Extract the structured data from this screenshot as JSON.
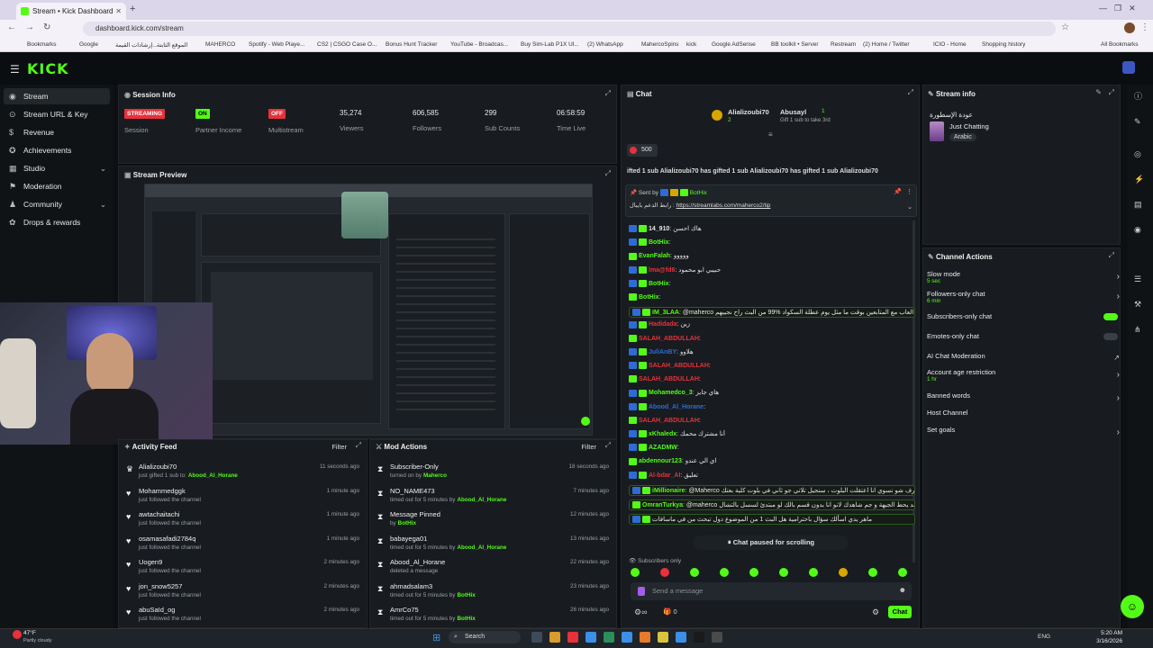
{
  "browser": {
    "tab_title": "Stream • Kick Dashboard",
    "url": "dashboard.kick.com/stream",
    "bookmarks": [
      "Bookmarks",
      "Google",
      "إرشادات القيمة...",
      "الموقع الثابتة",
      "MAHERCO",
      "Spotify - Web Playe...",
      "CS2 | CSGO Case O...",
      "Bonus Hunt Tracker",
      "YouTube - Broadcas...",
      "Buy Sim-Lab P1X Ul...",
      "(2) WhatsApp",
      "MahercoSpins",
      "kick",
      "Google AdSense",
      "BB toolkit • Server",
      "Restream",
      "(2) Home / Twitter",
      "ICIO - Home",
      "Shopping history",
      "All Bookmarks"
    ]
  },
  "kick": {
    "logo": "KICK",
    "sidebar": [
      {
        "label": "Stream",
        "icon": "stream-icon",
        "active": true
      },
      {
        "label": "Stream URL & Key",
        "icon": "key-icon"
      },
      {
        "label": "Revenue",
        "icon": "revenue-icon"
      },
      {
        "label": "Achievements",
        "icon": "achievement-icon"
      },
      {
        "label": "Studio",
        "icon": "studio-icon",
        "chevron": true
      },
      {
        "label": "Moderation",
        "icon": "moderation-icon"
      },
      {
        "label": "Community",
        "icon": "community-icon",
        "chevron": true
      },
      {
        "label": "Drops & rewards",
        "icon": "gift-icon"
      }
    ]
  },
  "session": {
    "title": "Session Info",
    "stats": [
      {
        "badge": "STREAMING",
        "badge_color": "#e8313a",
        "label": "Session"
      },
      {
        "badge": "ON",
        "badge_color": "#53fc18",
        "label": "Partner Income"
      },
      {
        "badge": "OFF",
        "badge_color": "#e8313a",
        "label": "Multistream"
      },
      {
        "value": "35,274",
        "label": "Viewers"
      },
      {
        "value": "606,585",
        "label": "Followers"
      },
      {
        "value": "299",
        "label": "Sub Counts"
      },
      {
        "value": "06:58:59",
        "label": "Time Live"
      }
    ]
  },
  "preview": {
    "title": "Stream Preview"
  },
  "activity": {
    "title": "Activity Feed",
    "filter": "Filter",
    "items": [
      {
        "name": "Alializoubi70",
        "desc": "just gifted 1 sub to:",
        "target": "Abood_Al_Horane",
        "time": "11 seconds ago"
      },
      {
        "name": "Mohammedggk",
        "desc": "just followed the channel",
        "time": "1 minute ago"
      },
      {
        "name": "awtachaitachi",
        "desc": "just followed the channel",
        "time": "1 minute ago"
      },
      {
        "name": "osamasafadi2784q",
        "desc": "just followed the channel",
        "time": "1 minute ago"
      },
      {
        "name": "Uogen9",
        "desc": "just followed the channel",
        "time": "2 minutes ago"
      },
      {
        "name": "jon_snow5257",
        "desc": "just followed the channel",
        "time": "2 minutes ago"
      },
      {
        "name": "abuSaId_og",
        "desc": "just followed the channel",
        "time": "2 minutes ago"
      }
    ]
  },
  "mod": {
    "title": "Mod Actions",
    "filter": "Filter",
    "items": [
      {
        "name": "Subscriber-Only",
        "desc": "turned on by",
        "by": "Maherco",
        "time": "18 seconds ago"
      },
      {
        "name": "NO_NAME473",
        "desc": "timed out for 5 minutes by",
        "by": "Abood_Al_Horane",
        "time": "7 minutes ago"
      },
      {
        "name": "Message Pinned",
        "desc": "by",
        "by": "BotHix",
        "time": "12 minutes ago"
      },
      {
        "name": "babayega01",
        "desc": "timed out for 5 minutes by",
        "by": "Abood_Al_Horane",
        "time": "13 minutes ago"
      },
      {
        "name": "Abood_Al_Horane",
        "desc": "deleted a message",
        "by": "",
        "time": "22 minutes ago"
      },
      {
        "name": "ahmadsalam3",
        "desc": "timed out for 5 minutes by",
        "by": "BotHix",
        "time": "23 minutes ago"
      },
      {
        "name": "AmrCo75",
        "desc": "timed out for 5 minutes by",
        "by": "BotHix",
        "time": "26 minutes ago"
      }
    ]
  },
  "chat": {
    "title": "Chat",
    "top_gifter": {
      "name": "Alializoubi70",
      "count": "2"
    },
    "second_gifter": {
      "name": "Abusayl",
      "count": "1",
      "note": "Gift 1 sub to take 3rd"
    },
    "goal": "500",
    "gift_ticker": "ifted 1 sub   Alializoubi70 has gifted 1 sub   Alializoubi70 has gifted 1 sub   Alializoubi70",
    "pinned_by": "Sent by",
    "pinned_user": "BotHix",
    "pinned_label": "رابط الدعم بايبال :",
    "pinned_link": "https://streamlabs.com/maherco2/tip",
    "messages": [
      {
        "user": "14_910",
        "text": "هاك احسن",
        "color": "#e6e6e6"
      },
      {
        "user": "BotHix",
        "text": "",
        "color": "#53fc18"
      },
      {
        "user": "EvanFalah",
        "text": "ووووو",
        "color": "#53fc18"
      },
      {
        "user": "lma@fd6",
        "text": "حبيبي ابو محمود",
        "color": "#e8313a"
      },
      {
        "user": "BotHix",
        "text": "",
        "color": "#53fc18"
      },
      {
        "user": "BotHix",
        "text": "",
        "color": "#53fc18"
      },
      {
        "user": "IM_3LAA",
        "text": "@maherco اعمل الشات للمشتركين عشان فرصة العاب مع المتابعين بوقت ما مثل يوم عطلة السكواد %99 من البث راح نجيبهم",
        "color": "#53fc18"
      },
      {
        "user": "Hadidada",
        "text": "زين",
        "color": "#e8313a"
      },
      {
        "user": "SALAH_ABDULLAH",
        "text": "",
        "color": "#e8313a"
      },
      {
        "user": "JuliAnBY",
        "text": "هلاوو",
        "color": "#2e6bd6"
      },
      {
        "user": "SALAH_ABDULLAH",
        "text": "",
        "color": "#e8313a"
      },
      {
        "user": "SALAH_ABDULLAH",
        "text": "",
        "color": "#e8313a"
      },
      {
        "user": "Mohamedco_3",
        "text": "هاي جايز",
        "color": "#53fc18"
      },
      {
        "user": "Abood_Al_Horane",
        "text": "",
        "color": "#2e6bd6"
      },
      {
        "user": "SALAH_ABDULLAH",
        "text": "",
        "color": "#e8313a"
      },
      {
        "user": "xKhaledx",
        "text": "أنا مشترك محمك",
        "color": "#53fc18"
      },
      {
        "user": "AZADMW",
        "text": "",
        "color": "#53fc18"
      },
      {
        "user": "abdennour123",
        "text": "اي الي عندو",
        "color": "#53fc18"
      },
      {
        "user": "Al-bdar_AI",
        "text": "تعليق",
        "color": "#e8313a"
      },
      {
        "user": "iMillionaire",
        "text": "@Maherco و الله ما يتعرف شو نسوي انا اعتقلت البلوت ، سنجيل تلاتي جو ثاني في بلوت كلية بعتك",
        "color": "#53fc18"
      },
      {
        "user": "OmranTurkya",
        "text": "@maherco لما في قاعد يحط الجيهة و جم شاهدك لانو انا بدون قسم بالك لو مبتدئ لسسل بالتشال",
        "color": "#53fc18"
      },
      {
        "user": "",
        "text": "ماهر يدي اسألك سؤال باحترامية هل البث 1 من الموضوع دول تبحث من في ماسافات",
        "color": "#e6e6e6"
      }
    ],
    "paused": "Chat paused for scrolling",
    "subs_only": "Subscribers only",
    "placeholder": "Send a message",
    "points": "0",
    "chat_button": "Chat"
  },
  "stream_info": {
    "title": "Stream info",
    "stream_title": "عودة الإسطورة",
    "category": "Just Chatting",
    "tag": "Arabic"
  },
  "channel_actions": {
    "title": "Channel Actions",
    "items": [
      {
        "name": "Slow mode",
        "sub": "5 sec",
        "control": "arrow"
      },
      {
        "name": "Followers-only chat",
        "sub": "6 min",
        "control": "arrow"
      },
      {
        "name": "Subscribers-only chat",
        "sub": "",
        "control": "toggle_on"
      },
      {
        "name": "Emotes-only chat",
        "sub": "",
        "control": "toggle_off"
      },
      {
        "name": "AI Chat Moderation",
        "sub": "",
        "control": "link"
      },
      {
        "name": "Account age restriction",
        "sub": "1 hr",
        "control": "arrow"
      },
      {
        "name": "Banned words",
        "sub": "",
        "control": "arrow"
      },
      {
        "name": "Host Channel",
        "sub": "",
        "control": "none"
      },
      {
        "name": "Set goals",
        "sub": "",
        "control": "arrow"
      }
    ]
  },
  "taskbar": {
    "weather_temp": "47°F",
    "weather_desc": "Partly cloudy",
    "search": "Search",
    "lang": "ENG",
    "time": "5:20 AM",
    "date": "3/16/2026"
  },
  "colors": {
    "accent": "#53fc18",
    "red": "#e8313a",
    "blue": "#2e6bd6"
  }
}
